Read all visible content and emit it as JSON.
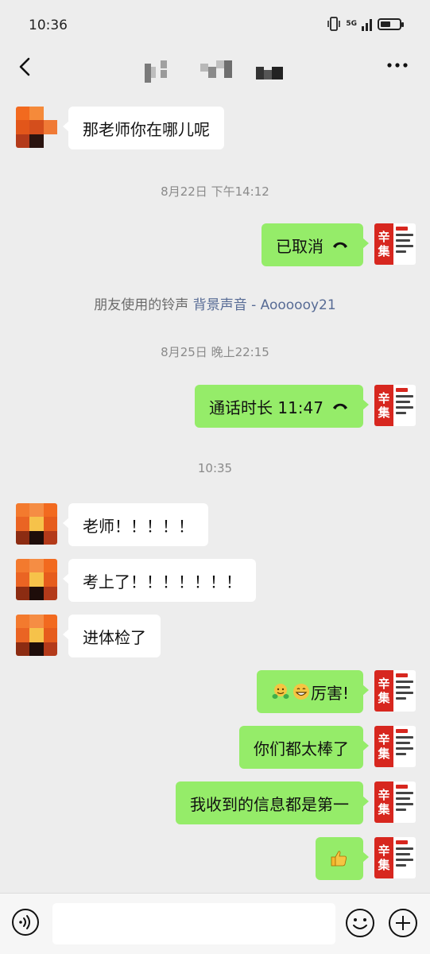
{
  "status_bar": {
    "time": "10:36",
    "network": "5G",
    "battery_level": 0.55
  },
  "header": {
    "back_icon": "chevron-left-icon",
    "more_icon": "more-dots-icon"
  },
  "messages": {
    "m1": "那老师你在哪儿呢",
    "ts1": "8月22日 下午14:12",
    "m2": "已取消",
    "system_prefix": "朋友使用的铃声",
    "system_link": "背景声音 - Aoooooy21",
    "ts2": "8月25日 晚上22:15",
    "m3": "通话时长 11:47",
    "ts3": "10:35",
    "m4": "老师！！！！！",
    "m5": "考上了！！！！！！！",
    "m6": "进体检了",
    "m7_text": "厉害!",
    "m8": "你们都太棒了",
    "m9": "我收到的信息都是第一"
  },
  "app_avatar": {
    "line1": "辛",
    "line2": "集"
  },
  "colors": {
    "outgoing_bubble": "#95ec69",
    "incoming_bubble": "#ffffff",
    "background": "#ededed",
    "link": "#576b95"
  }
}
